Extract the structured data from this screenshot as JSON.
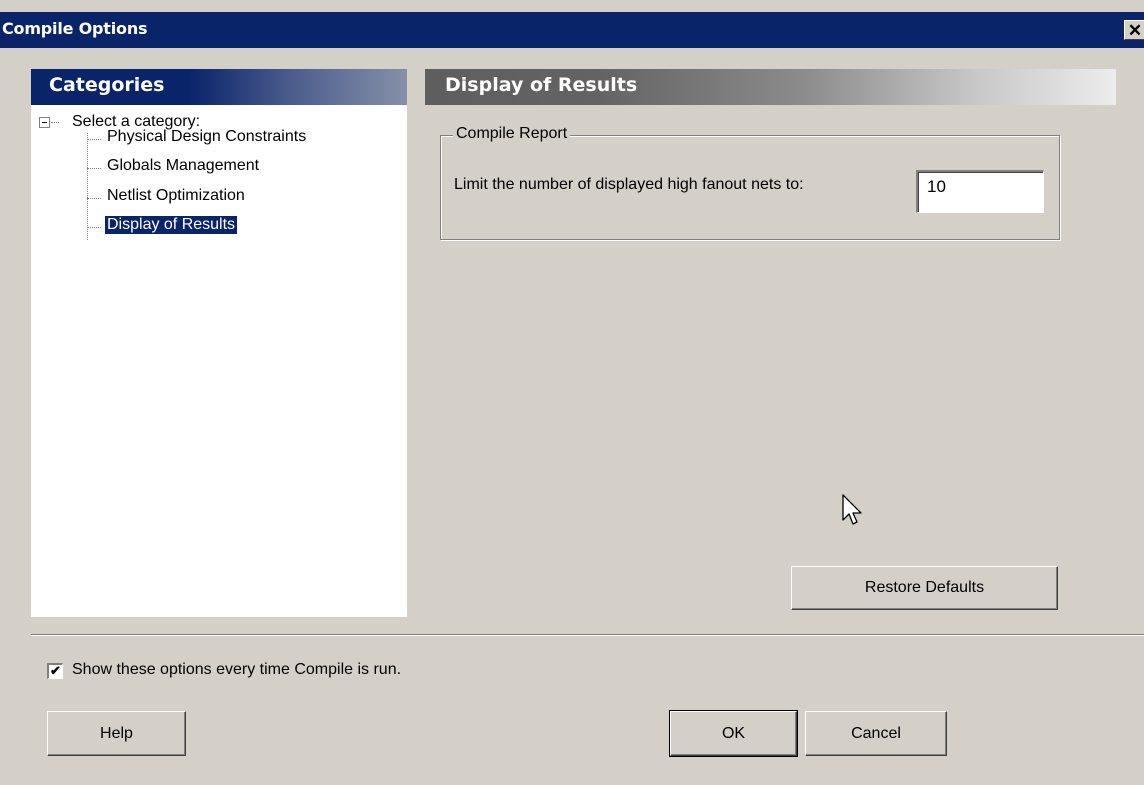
{
  "window": {
    "title": "Compile Options",
    "close_glyph": "✕"
  },
  "categories": {
    "header": "Categories",
    "root_label": "Select a category:",
    "items": [
      {
        "label": "Physical Design Constraints",
        "selected": false
      },
      {
        "label": "Globals Management",
        "selected": false
      },
      {
        "label": "Netlist Optimization",
        "selected": false
      },
      {
        "label": "Display of Results",
        "selected": true
      }
    ]
  },
  "panel": {
    "header": "Display of Results",
    "group_title": "Compile Report",
    "limit_label": "Limit the number of displayed high fanout nets to:",
    "limit_value": "10",
    "restore_label": "Restore Defaults"
  },
  "footer": {
    "show_options_label": "Show these options every time Compile is run.",
    "show_options_checked": true,
    "check_glyph": "✔",
    "help_label": "Help",
    "ok_label": "OK",
    "cancel_label": "Cancel"
  },
  "colors": {
    "dialog_bg": "#d4d0c8",
    "titlebar": "#0a246a",
    "selection": "#0a246a"
  },
  "icons": [
    "close-icon",
    "collapse-icon",
    "mouse-cursor-icon"
  ]
}
